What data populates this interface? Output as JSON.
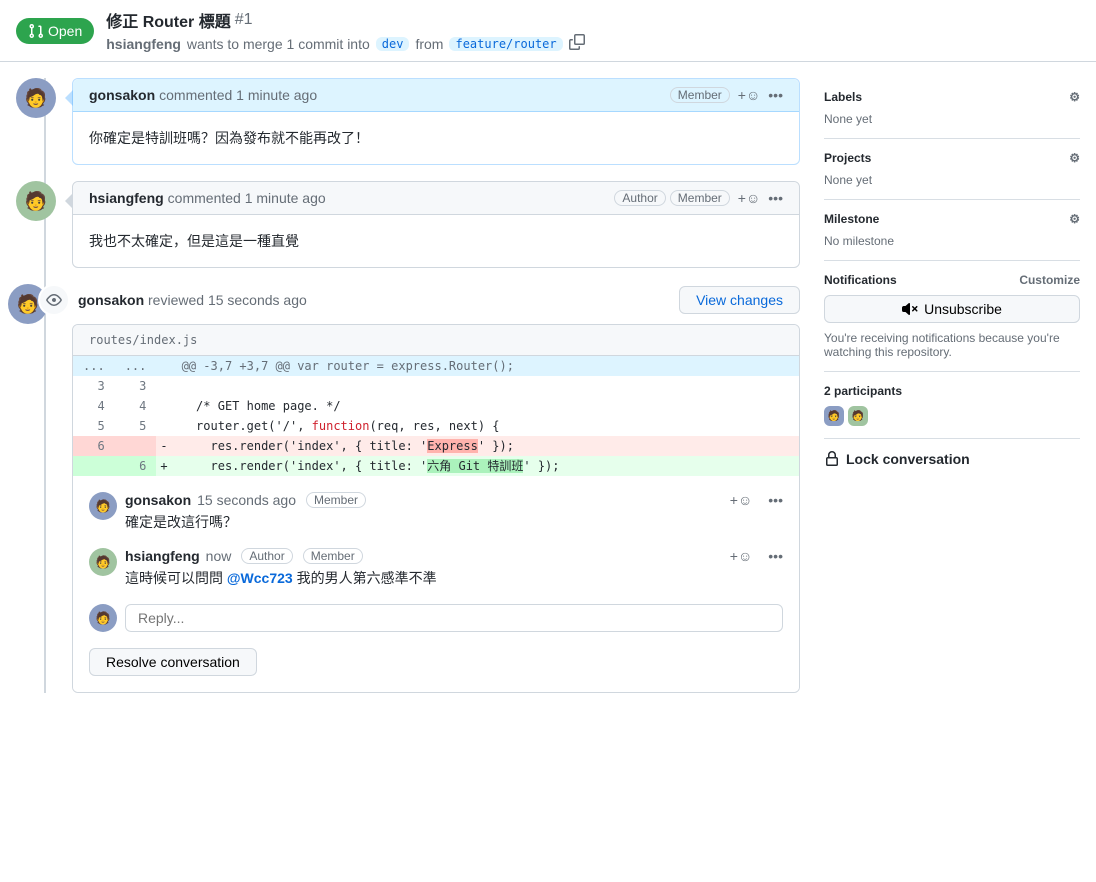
{
  "header": {
    "status": "Open",
    "title": "修正 Router 標題",
    "number": "#1",
    "author": "hsiangfeng",
    "merge_text": "wants to merge 1 commit into",
    "base_branch": "dev",
    "from_text": "from",
    "head_branch": "feature/router"
  },
  "comments": [
    {
      "user": "gonsakon",
      "time": "1 minute ago",
      "badges": [
        "Member"
      ],
      "body": "你確定是特訓班嗎？因為發布就不能再改了！",
      "header_style": "blue"
    },
    {
      "user": "hsiangfeng",
      "time": "1 minute ago",
      "badges": [
        "Author",
        "Member"
      ],
      "body": "我也不太確定，但是這是一種直覺",
      "header_style": "plain"
    }
  ],
  "review": {
    "user": "gonsakon",
    "action": "reviewed",
    "time": "15 seconds ago",
    "view_changes": "View changes",
    "file": "routes/index.js",
    "hunk": "@@ -3,7 +3,7 @@ var router = express.Router();",
    "lines": [
      {
        "old": "3",
        "new": "3",
        "sign": " ",
        "text": "",
        "cls": "ctx"
      },
      {
        "old": "4",
        "new": "4",
        "sign": " ",
        "text": "  /* GET home page. */",
        "cls": "ctx"
      },
      {
        "old": "5",
        "new": "5",
        "sign": " ",
        "text": "  router.get('/', ",
        "keyword": "function",
        "tail": "(req, res, next) {",
        "cls": "ctx"
      },
      {
        "old": "6",
        "new": "",
        "sign": "-",
        "text": "    res.render('index', { title: '",
        "hl": "Express",
        "tail2": "' });",
        "cls": "del"
      },
      {
        "old": "",
        "new": "6",
        "sign": "+",
        "text": "    res.render('index', { title: '",
        "hl": "六角 Git 特訓班",
        "tail2": "' });",
        "cls": "add"
      }
    ],
    "review_comments": [
      {
        "user": "gonsakon",
        "time": "15 seconds ago",
        "badges": [
          "Member"
        ],
        "body": "確定是改這行嗎？"
      },
      {
        "user": "hsiangfeng",
        "time": "now",
        "badges": [
          "Author",
          "Member"
        ],
        "body_prefix": "這時候可以問問 ",
        "mention": "@Wcc723",
        "body_suffix": " 我的男人第六感準不準"
      }
    ],
    "reply_placeholder": "Reply...",
    "resolve": "Resolve conversation"
  },
  "sidebar": {
    "labels": {
      "title": "Labels",
      "value": "None yet"
    },
    "projects": {
      "title": "Projects",
      "value": "None yet"
    },
    "milestone": {
      "title": "Milestone",
      "value": "No milestone"
    },
    "notifications": {
      "title": "Notifications",
      "customize": "Customize",
      "unsubscribe": "Unsubscribe",
      "note": "You're receiving notifications because you're watching this repository."
    },
    "participants": {
      "count": "2 participants"
    },
    "lock": "Lock conversation"
  }
}
